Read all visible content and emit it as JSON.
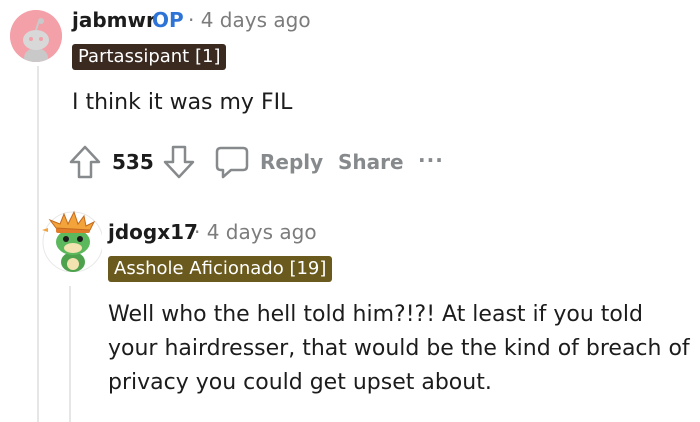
{
  "comment1": {
    "username": "jabmwr",
    "op_badge": "OP",
    "time": "· 4 days ago",
    "flair": "Partassipant [1]",
    "body": "I think it was my FIL",
    "votes": "535",
    "reply_label": "Reply",
    "share_label": "Share",
    "more_label": "···"
  },
  "comment2": {
    "username": "jdogx17",
    "time": "· 4 days ago",
    "flair": "Asshole Aficionado [19]",
    "body": "Well who the hell told him?!?! At least if you told your hairdresser, that would be the kind of breach of privacy you could get upset about."
  },
  "colors": {
    "flair1_bg": "#3a2a20",
    "flair2_bg": "#6b5a1e",
    "op_color": "#2e74d6",
    "avatar1_bg": "#f4a0a8"
  }
}
